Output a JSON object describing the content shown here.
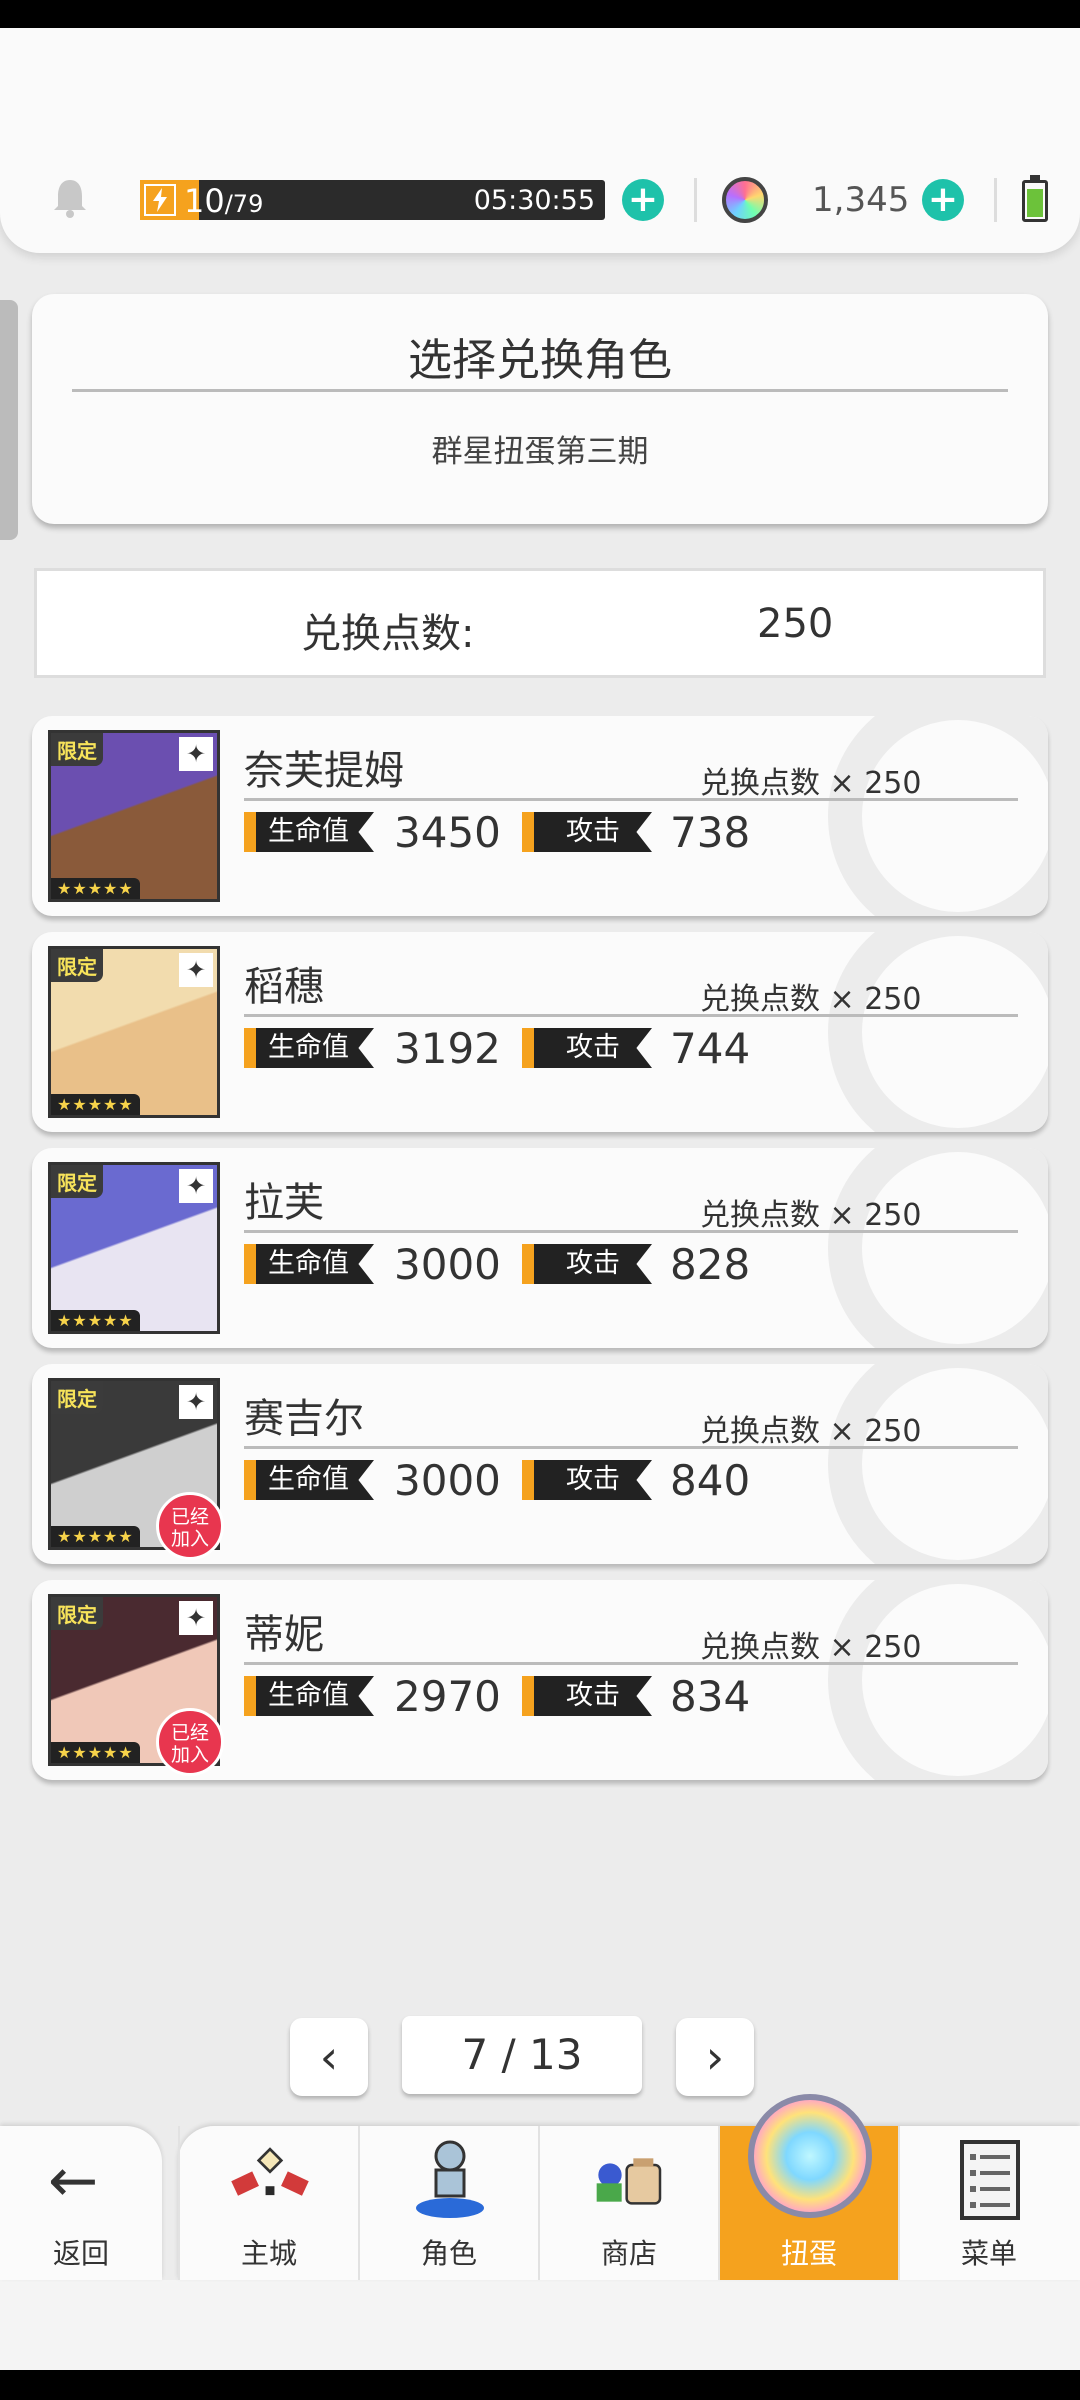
{
  "topbar": {
    "stamina_current": "10",
    "stamina_max": "/79",
    "stamina_fraction": 0.127,
    "stamina_timer": "05:30:55",
    "gem_count": "1,345",
    "plus": "+"
  },
  "header": {
    "title": "选择兑换角色",
    "subtitle": "群星扭蛋第三期"
  },
  "points": {
    "label": "兑换点数:",
    "value": "250"
  },
  "common": {
    "limited": "限定",
    "stars": "★★★★★",
    "hp_label": "生命值",
    "atk_label": "攻击",
    "joined": [
      "已经",
      "加入"
    ]
  },
  "characters": [
    {
      "name": "奈芙提姆",
      "cost": "兑换点数 × 250",
      "hp": "3450",
      "atk": "738",
      "element": "✦",
      "joined": false,
      "art": [
        "#6b4fb0",
        "#8a5a3a"
      ]
    },
    {
      "name": "稻穗",
      "cost": "兑换点数 × 250",
      "hp": "3192",
      "atk": "744",
      "element": "✦",
      "joined": false,
      "art": [
        "#f2dcae",
        "#e9c089"
      ]
    },
    {
      "name": "拉芙",
      "cost": "兑换点数 × 250",
      "hp": "3000",
      "atk": "828",
      "element": "✦",
      "joined": false,
      "art": [
        "#6a6ad0",
        "#e8e4f2"
      ]
    },
    {
      "name": "赛吉尔",
      "cost": "兑换点数 × 250",
      "hp": "3000",
      "atk": "840",
      "element": "✦",
      "joined": true,
      "art": [
        "#3a3a3a",
        "#cfcfcf"
      ]
    },
    {
      "name": "蒂妮",
      "cost": "兑换点数 × 250",
      "hp": "2970",
      "atk": "834",
      "element": "✦",
      "joined": true,
      "art": [
        "#4a2a30",
        "#f0c8b8"
      ]
    }
  ],
  "pagination": {
    "prev": "‹",
    "next": "›",
    "indicator": "7 / 13"
  },
  "nav": {
    "back_label": "返回",
    "back_icon": "←",
    "items": [
      {
        "label": "主城",
        "icon": "castle-icon"
      },
      {
        "label": "角色",
        "icon": "character-icon"
      },
      {
        "label": "商店",
        "icon": "shop-icon"
      },
      {
        "label": "扭蛋",
        "icon": "gacha-icon",
        "active": true
      },
      {
        "label": "菜单",
        "icon": "menu-icon"
      }
    ]
  },
  "colors": {
    "accent": "#f5a21e",
    "teal": "#1ec2aa",
    "badge_red": "#e8364f"
  }
}
